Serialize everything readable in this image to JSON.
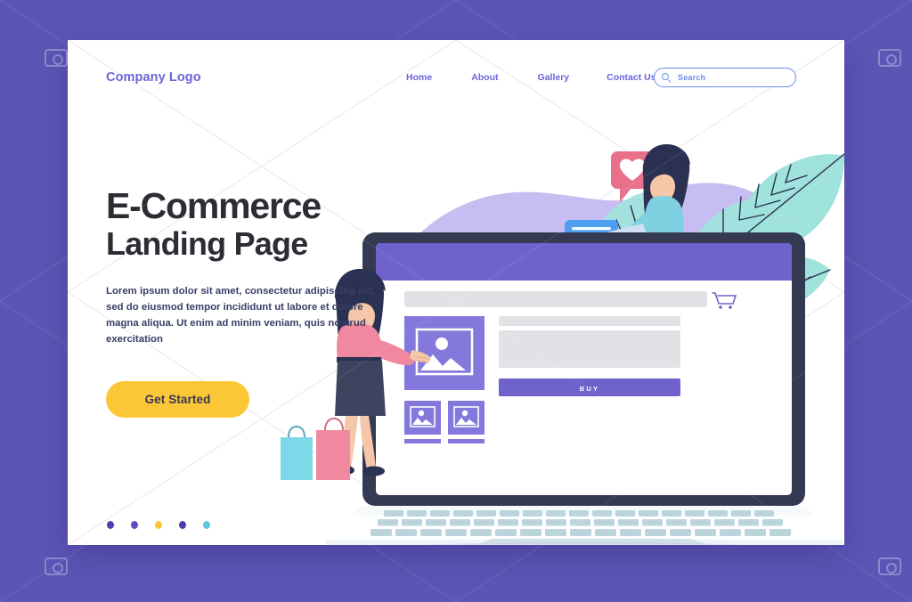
{
  "page": {
    "backdrop_color": "#5b55b5",
    "card_color": "#ffffff"
  },
  "header": {
    "logo": "Company Logo",
    "nav": [
      {
        "label": "Home"
      },
      {
        "label": "About"
      },
      {
        "label": "Gallery"
      },
      {
        "label": "Contact Us"
      }
    ],
    "search": {
      "placeholder": "Search",
      "value": "",
      "icon": "search-icon",
      "border_color": "#6b8df0"
    },
    "link_color": "#6c63d8"
  },
  "hero": {
    "headline_line1": "E-Commerce",
    "headline_line2": "Landing Page",
    "paragraph": "Lorem ipsum dolor sit amet, consectetur adipiscing elit, sed do eiusmod tempor incididunt ut labore et dolore magna aliqua. Ut enim ad minim veniam, quis nostrud exercitation",
    "cta_label": "Get Started",
    "cta_color": "#fbc736",
    "headline_color": "#2c2c35",
    "paragraph_color": "#3a3e66"
  },
  "carousel": {
    "dots": [
      {
        "color": "#4a3fb0",
        "active": true
      },
      {
        "color": "#5b4fc4",
        "active": false
      },
      {
        "color": "#fbc736",
        "active": false
      },
      {
        "color": "#4a3fb0",
        "active": false
      },
      {
        "color": "#5ec8e3",
        "active": false
      }
    ]
  },
  "illustration": {
    "blob_color": "#c7bdf0",
    "laptop": {
      "bezel_color": "#343a52",
      "base_color": "#ffffff",
      "key_color": "#bcd4dc",
      "screen": {
        "topbar_color": "#6f62cd",
        "search_bar": "placeholder-bar",
        "cart_icon": "shopping-cart-icon",
        "hero_image": "image-placeholder-icon",
        "thumb_1": "image-placeholder-icon",
        "thumb_2": "image-placeholder-icon",
        "text_lines": 2,
        "buy_label": "BUY",
        "buy_color": "#6f62cd",
        "placeholder_color": "#8478dd",
        "grey_color": "#e2e2e6"
      }
    },
    "reactions": [
      {
        "type": "heart-bubble-icon",
        "color": "#e8708a"
      },
      {
        "type": "heart-eyes-emoji-icon",
        "color": "#fbc736"
      },
      {
        "type": "chat-bubble-icon",
        "color": "#4b9ef0"
      },
      {
        "type": "heart-bubble-icon",
        "color": "#e8708a"
      }
    ],
    "characters": [
      {
        "name": "standing-woman",
        "hair": "#2b3152",
        "top": "#f0899f",
        "skirt": "#3c4460",
        "skin": "#f5c6a8"
      },
      {
        "name": "seated-woman-with-laptop",
        "hair": "#2b3152",
        "top": "#7fd0e0",
        "pants": "#2b3152",
        "skin": "#f5c6a8"
      }
    ],
    "shopping_bags": [
      {
        "color": "#7fd8e8"
      },
      {
        "color": "#f0899f"
      }
    ],
    "leaves_color": "#9fe3dc",
    "dot_cluster_color": "#4a3fb0"
  }
}
